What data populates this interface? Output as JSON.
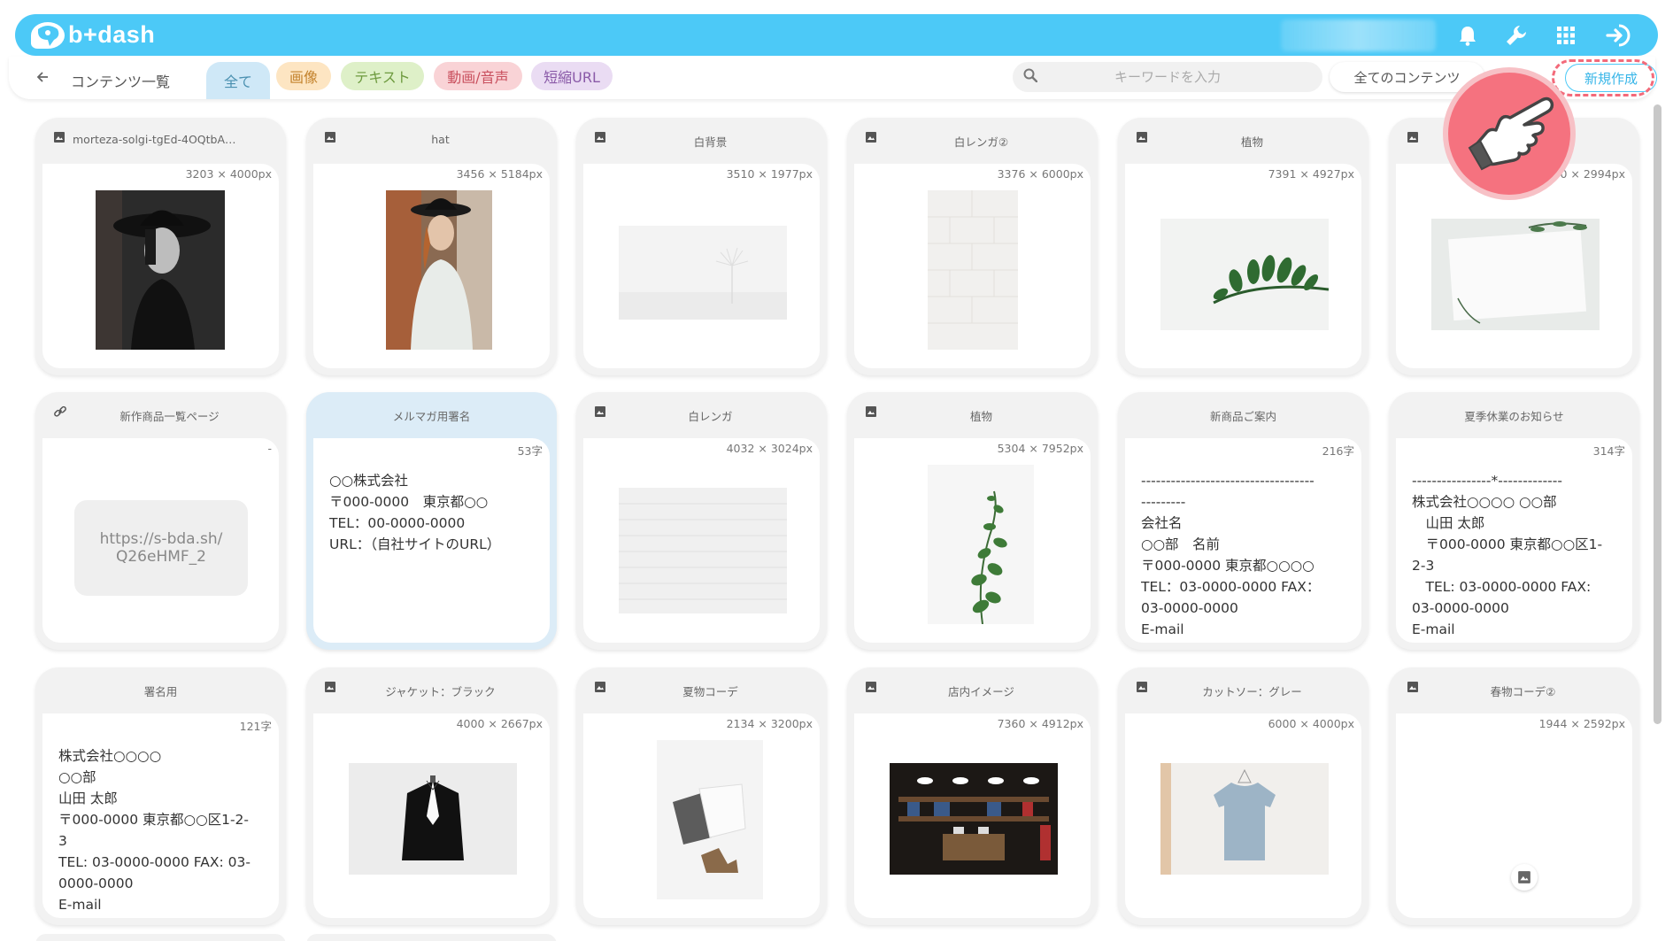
{
  "header": {
    "logo_text": "b+dash",
    "icons": [
      "bell-icon",
      "wrench-icon",
      "grid-icon",
      "logout-icon"
    ]
  },
  "filterbar": {
    "breadcrumb": "コンテンツ一覧",
    "chips": {
      "all": "全て",
      "image": "画像",
      "text": "テキスト",
      "av": "動画/音声",
      "url": "短縮URL"
    },
    "search_placeholder": "キーワードを入力",
    "scope": "全てのコンテンツ",
    "new_button": "新規作成"
  },
  "cards": [
    {
      "type": "image",
      "title": "morteza-solgi-tgEd-4OQtbA…",
      "meta": "3203 × 4000px"
    },
    {
      "type": "image",
      "title": "hat",
      "meta": "3456 × 5184px"
    },
    {
      "type": "image",
      "title": "白背景",
      "meta": "3510 × 1977px"
    },
    {
      "type": "image",
      "title": "白レンガ②",
      "meta": "3376 × 6000px"
    },
    {
      "type": "image",
      "title": "植物",
      "meta": "7391 × 4927px"
    },
    {
      "type": "image",
      "title": "",
      "meta": "0 × 2994px"
    },
    {
      "type": "url",
      "title": "新作商品一覧ページ",
      "meta": "-",
      "url": "https://s-bda.sh/\nQ26eHMF_2"
    },
    {
      "type": "text",
      "title": "メルマガ用署名",
      "meta": "53字",
      "text": "○○株式会社\n〒000-0000　東京都○○\nTEL：00-0000-0000\nURL：（自社サイトのURL）"
    },
    {
      "type": "image",
      "title": "白レンガ",
      "meta": "4032 × 3024px"
    },
    {
      "type": "image",
      "title": "植物",
      "meta": "5304 × 7952px"
    },
    {
      "type": "text",
      "title": "新商品ご案内",
      "meta": "216字",
      "text": "-----------------------------------\n---------\n会社名\n○○部　名前\n〒000-0000 東京都○○○○\nTEL：03-0000-0000 FAX：\n03-0000-0000\nE-mail"
    },
    {
      "type": "text",
      "title": "夏季休業のお知らせ",
      "meta": "314字",
      "text": "----------------*-------------\n株式会社○○○○ ○○部\n　山田 太郎\n　〒000-0000 東京都○○区1-\n2-3\n　TEL: 03-0000-0000 FAX:\n03-0000-0000\nE-mail"
    },
    {
      "type": "text",
      "title": "署名用",
      "meta": "121字",
      "text": "株式会社○○○○\n○○部\n山田 太郎\n〒000-0000 東京都○○区1-2-\n3\nTEL: 03-0000-0000 FAX: 03-\n0000-0000\nE-mail"
    },
    {
      "type": "image",
      "title": "ジャケット：ブラック",
      "meta": "4000 × 2667px"
    },
    {
      "type": "image",
      "title": "夏物コーデ",
      "meta": "2134 × 3200px"
    },
    {
      "type": "image",
      "title": "店内イメージ",
      "meta": "7360 × 4912px"
    },
    {
      "type": "image",
      "title": "カットソー：グレー",
      "meta": "6000 × 4000px"
    },
    {
      "type": "image",
      "title": "春物コーデ②",
      "meta": "1944 × 2592px"
    }
  ],
  "colors": {
    "accent": "#4cc9f7",
    "highlight": "#f36a7a"
  }
}
